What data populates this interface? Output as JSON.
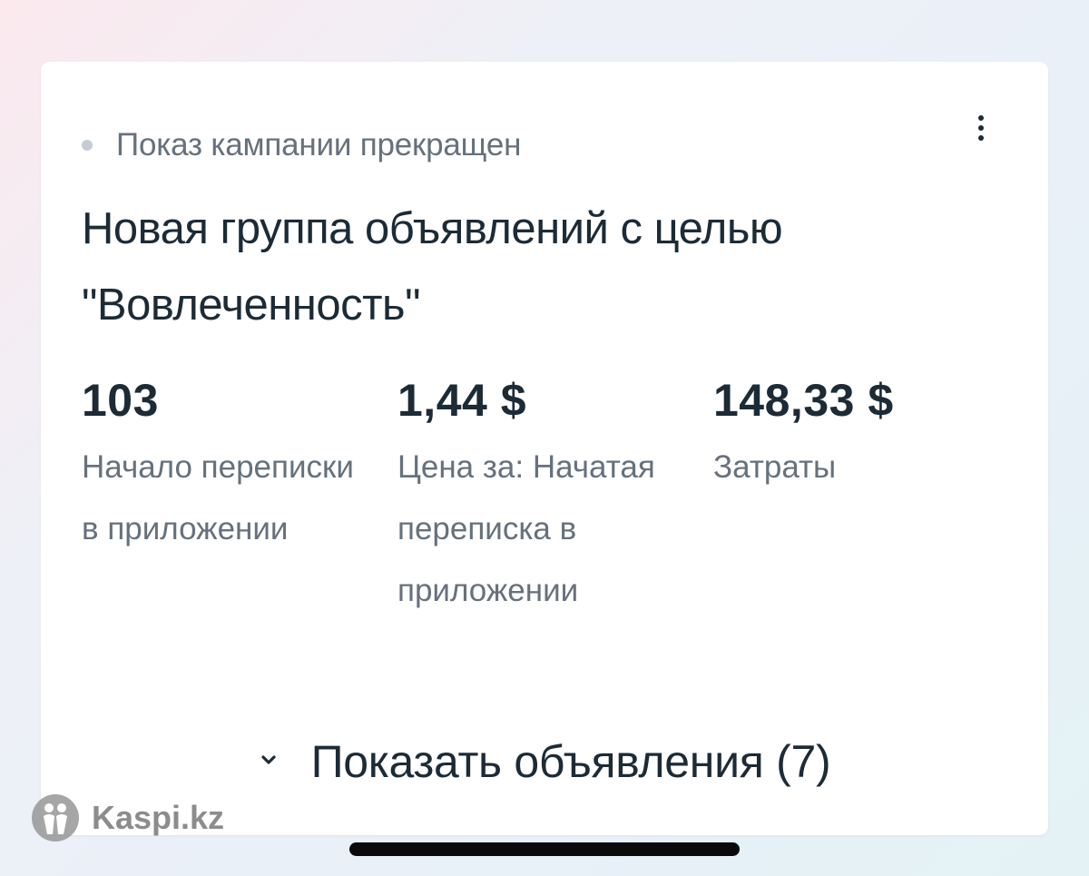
{
  "campaign": {
    "status_text": "Показ кампании прекращен",
    "status_color": "#c5ccd3",
    "title": "Новая группа объявлений с целью \"Вовлеченность\"",
    "more_icon": "more-vertical-icon"
  },
  "metrics": [
    {
      "value": "103",
      "label": "Начало переписки в приложении"
    },
    {
      "value": "1,44 $",
      "label": "Цена за: Начатая переписка в приложении"
    },
    {
      "value": "148,33 $",
      "label": "Затраты"
    }
  ],
  "show_ads": {
    "label": "Показать объявления (7)",
    "icon": "chevron-down-icon"
  },
  "watermark": {
    "text": "Kaspi.kz"
  }
}
